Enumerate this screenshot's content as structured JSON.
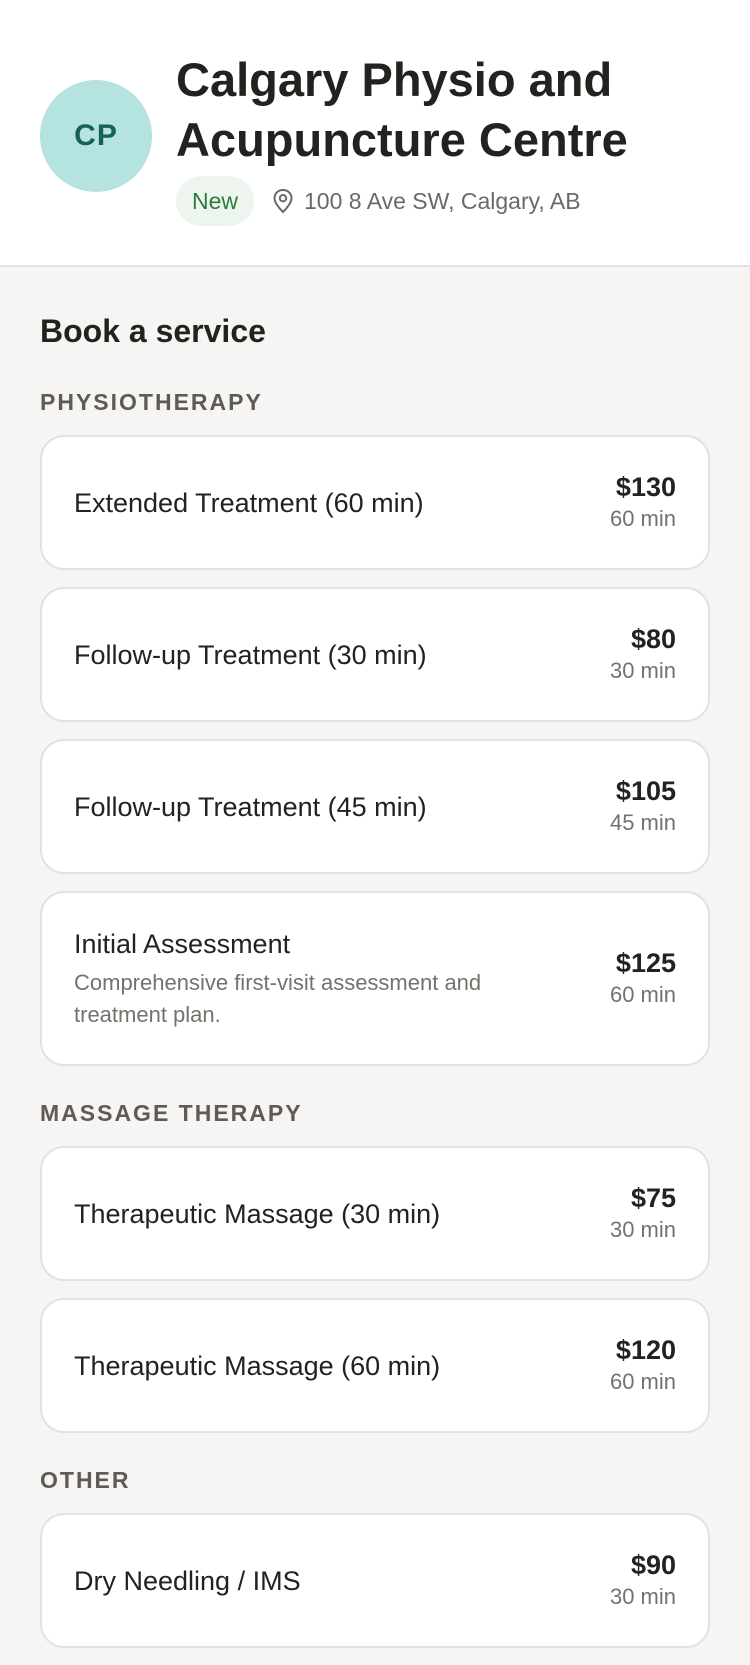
{
  "clinic": {
    "initials": "CP",
    "name": "Calgary Physio and Acupuncture Centre",
    "badge": "New",
    "address": "100 8 Ave SW, Calgary, AB"
  },
  "booking": {
    "title": "Book a service",
    "sections": [
      {
        "label": "PHYSIOTHERAPY",
        "services": [
          {
            "name": "Extended Treatment (60 min)",
            "price": "$130",
            "duration": "60 min"
          },
          {
            "name": "Follow-up Treatment (30 min)",
            "price": "$80",
            "duration": "30 min"
          },
          {
            "name": "Follow-up Treatment (45 min)",
            "price": "$105",
            "duration": "45 min"
          },
          {
            "name": "Initial Assessment",
            "description": "Comprehensive first-visit assessment and treatment plan.",
            "price": "$125",
            "duration": "60 min"
          }
        ]
      },
      {
        "label": "MASSAGE THERAPY",
        "services": [
          {
            "name": "Therapeutic Massage (30 min)",
            "price": "$75",
            "duration": "30 min"
          },
          {
            "name": "Therapeutic Massage (60 min)",
            "price": "$120",
            "duration": "60 min"
          }
        ]
      },
      {
        "label": "OTHER",
        "services": [
          {
            "name": "Dry Needling / IMS",
            "price": "$90",
            "duration": "30 min"
          }
        ]
      }
    ]
  }
}
